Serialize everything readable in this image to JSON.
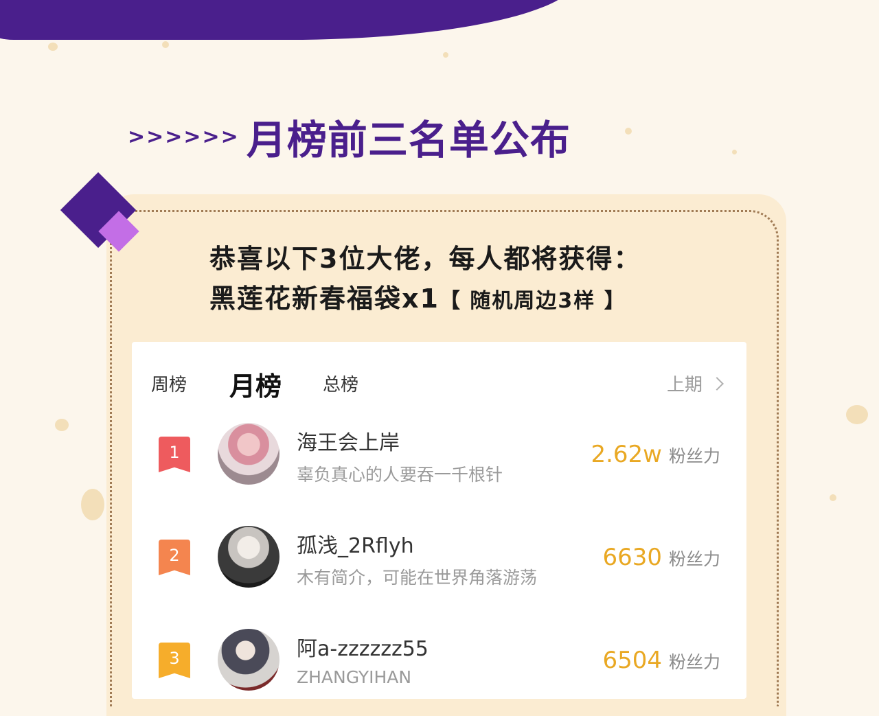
{
  "headline": {
    "arrows": ">>>>>>",
    "title": "月榜前三名单公布"
  },
  "intro": {
    "line1": "恭喜以下3位大佬，每人都将获得：",
    "line2_main": "黑莲花新春福袋x1",
    "line2_bracket": "【 随机周边3样 】"
  },
  "tabs": {
    "weekly": "周榜",
    "monthly": "月榜",
    "total": "总榜",
    "previous": "上期"
  },
  "ranking": [
    {
      "rank": "1",
      "name": "海王会上岸",
      "bio": "辜负真心的人要吞一千根针",
      "fans": "2.62w",
      "fans_label": "粉丝力"
    },
    {
      "rank": "2",
      "name": "孤浅_2Rflyh",
      "bio": "木有简介，可能在世界角落游荡",
      "fans": "6630",
      "fans_label": "粉丝力"
    },
    {
      "rank": "3",
      "name": "阿a-zzzzzz55",
      "bio": "ZHANGYIHAN",
      "fans": "6504",
      "fans_label": "粉丝力"
    }
  ],
  "colors": {
    "brand_purple": "#4a1f8c",
    "accent_pink": "#c36ee6",
    "fans_gold": "#e9a823",
    "rank1": "#ee5b5e",
    "rank2": "#f4854f",
    "rank3": "#f6ad2b"
  }
}
